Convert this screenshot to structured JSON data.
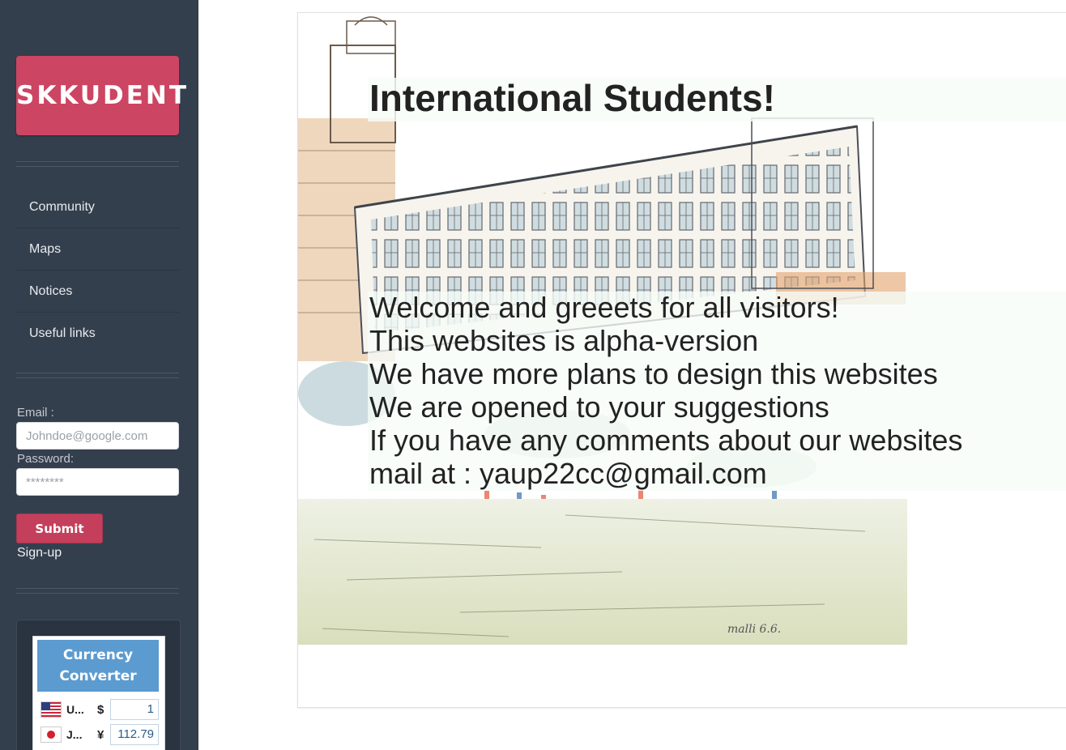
{
  "sidebar": {
    "logo": "SKKUDENT",
    "nav": [
      {
        "label": "Community"
      },
      {
        "label": "Maps"
      },
      {
        "label": "Notices"
      },
      {
        "label": "Useful links"
      }
    ],
    "login": {
      "email_label": "Email :",
      "email_placeholder": "Johndoe@google.com",
      "password_label": "Password:",
      "password_placeholder": "********",
      "submit_label": "Submit",
      "signup_label": "Sign-up"
    },
    "currency_widget": {
      "title": "Currency Converter",
      "rows": [
        {
          "code": "U...",
          "symbol": "$",
          "value": "1",
          "flag": "us-flag-icon"
        },
        {
          "code": "J...",
          "symbol": "¥",
          "value": "112.79",
          "flag": "jp-flag-icon"
        }
      ]
    }
  },
  "main": {
    "title": "International Students!",
    "message_lines": [
      "Welcome and greeets for all visitors!",
      "This websites is alpha-version",
      "We have more plans to design this websites",
      "We are opened to your suggestions",
      "If you have any comments about our websites",
      "mail at : yaup22cc@gmail.com"
    ],
    "background_image": "campus-sketch-image",
    "colors": {
      "accent": "#cc4562",
      "sidebar": "#343f4e",
      "widget_header": "#5b9bd0"
    }
  }
}
